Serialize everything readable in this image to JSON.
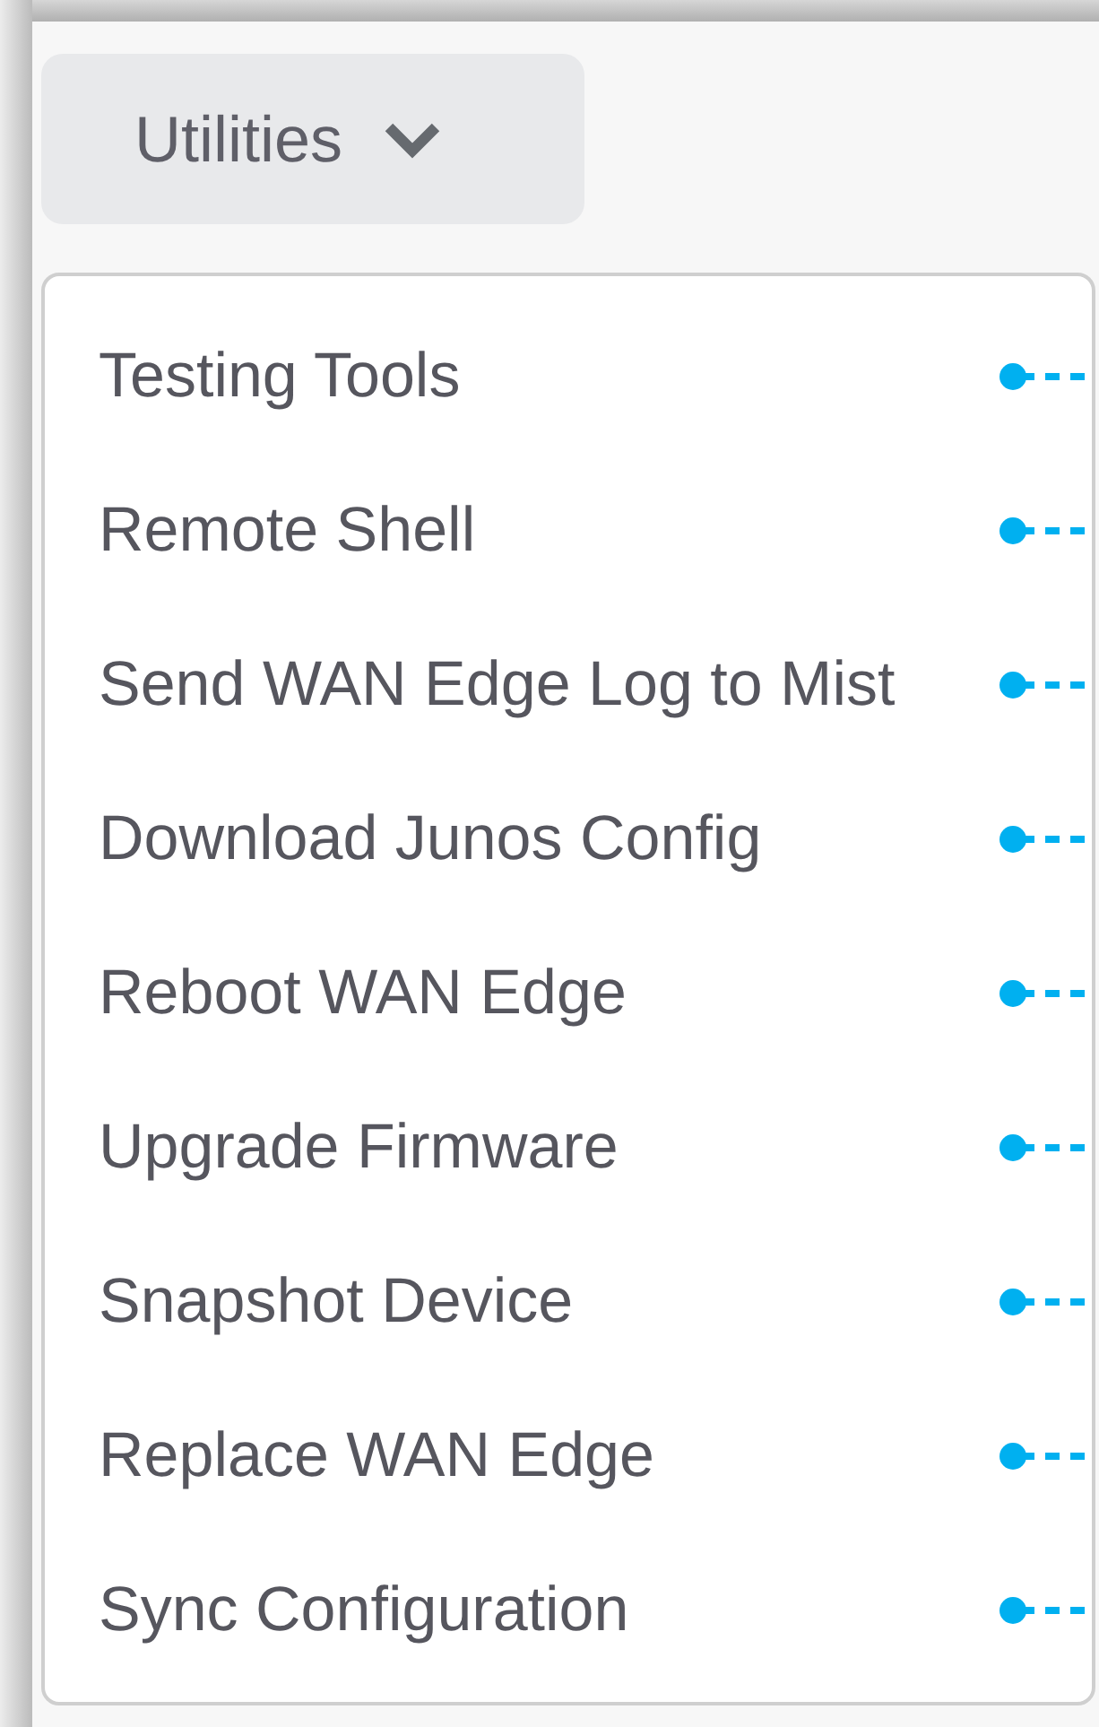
{
  "dropdown_button": {
    "label": "Utilities"
  },
  "menu": {
    "items": [
      {
        "label": "Testing Tools"
      },
      {
        "label": "Remote Shell"
      },
      {
        "label": "Send WAN Edge Log to Mist"
      },
      {
        "label": "Download Junos Config"
      },
      {
        "label": "Reboot WAN Edge"
      },
      {
        "label": "Upgrade Firmware"
      },
      {
        "label": "Snapshot Device"
      },
      {
        "label": "Replace WAN Edge"
      },
      {
        "label": "Sync Configuration"
      }
    ]
  }
}
